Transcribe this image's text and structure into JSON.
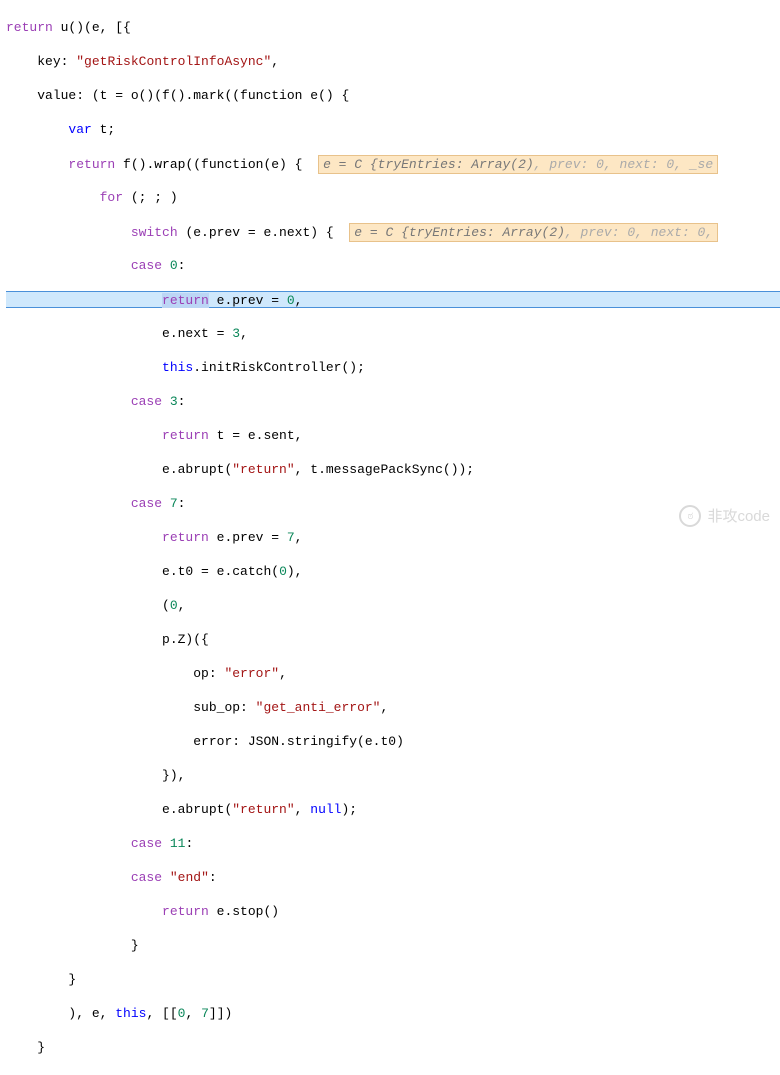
{
  "tokens": {
    "return": "return",
    "var": "var",
    "for": "for",
    "switch": "switch",
    "case": "case",
    "this": "this",
    "null": "null"
  },
  "code": {
    "l1_a": " u()(e, [{",
    "l2_key": "key: ",
    "l2_str": "\"getRiskControlInfoAsync\"",
    "l2_end": ",",
    "l3": "value: (t = o()(f().mark((function e() {",
    "l4": " t;",
    "l5_a": " f().wrap((function(e) {  ",
    "l6": " (; ; )",
    "l7_a": " (e.prev = e.next) {  ",
    "l8_a": " ",
    "l8_b": "0",
    "l8_c": ":",
    "l9_a": " e.prev = ",
    "l9_b": "0",
    "l9_c": ",",
    "l10_a": "e.next = ",
    "l10_b": "3",
    "l10_c": ",",
    "l11": ".initRiskController();",
    "l12_a": " ",
    "l12_b": "3",
    "l12_c": ":",
    "l13": " t = e.sent,",
    "l14_a": "e.abrupt(",
    "l14_b": "\"return\"",
    "l14_c": ", t.messagePackSync());",
    "l15_a": " ",
    "l15_b": "7",
    "l15_c": ":",
    "l16_a": " e.prev = ",
    "l16_b": "7",
    "l16_c": ",",
    "l17_a": "e.t0 = e.catch(",
    "l17_b": "0",
    "l17_c": "),",
    "l18_a": "(",
    "l18_b": "0",
    "l18_c": ",",
    "l19": "p.Z)({",
    "l20_a": "op: ",
    "l20_b": "\"error\"",
    "l20_c": ",",
    "l21_a": "sub_op: ",
    "l21_b": "\"get_anti_error\"",
    "l21_c": ",",
    "l22": "error: JSON.stringify(e.t0)",
    "l23": "}),",
    "l24_a": "e.abrupt(",
    "l24_b": "\"return\"",
    "l24_c": ", ",
    "l24_d": ");",
    "l25_a": " ",
    "l25_b": "11",
    "l25_c": ":",
    "l26_a": " ",
    "l26_b": "\"end\"",
    "l26_c": ":",
    "l27": " e.stop()",
    "l28": "}",
    "l29": "}",
    "l30_a": "), e, ",
    "l30_b": ", [[",
    "l30_c": "0",
    "l30_d": ", ",
    "l30_e": "7",
    "l30_f": "]])",
    "l31": "}"
  },
  "debug": {
    "hint1_a": "e = C {tryEntries: Array(2)",
    "hint1_b": ", prev: 0, next: 0, _se",
    "hint2_a": "e = C {tryEntries: Array(2)",
    "hint2_b": ", prev: 0, next: 0,"
  },
  "watermark": {
    "text": "非攻code",
    "icon_glyph": "ಠ"
  }
}
